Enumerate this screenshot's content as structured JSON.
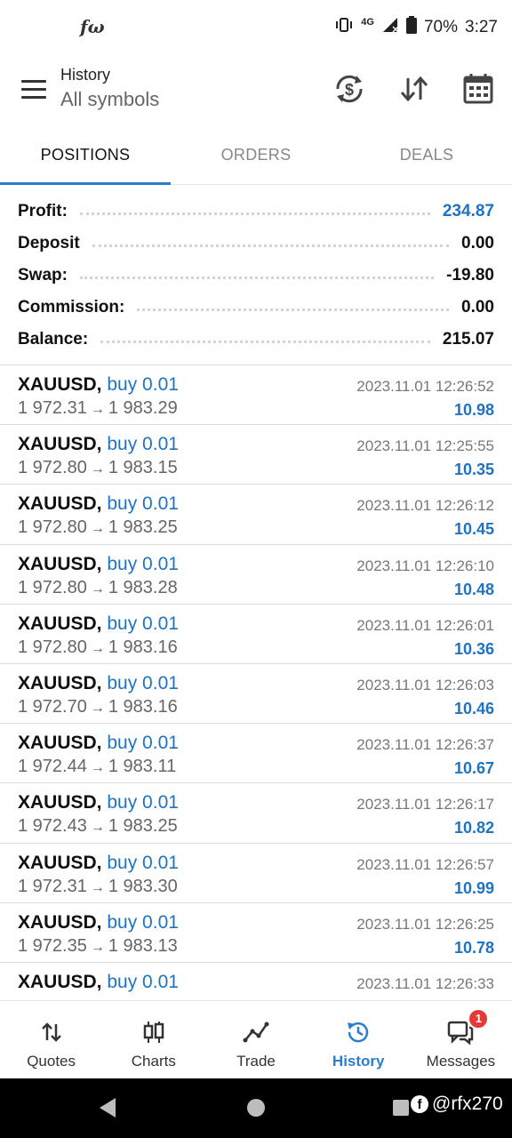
{
  "status_bar": {
    "left_icon": "fω",
    "network": "4G",
    "battery": "70%",
    "time": "3:27"
  },
  "header": {
    "title": "History",
    "subtitle": "All symbols"
  },
  "tabs": [
    {
      "label": "POSITIONS",
      "active": true
    },
    {
      "label": "ORDERS",
      "active": false
    },
    {
      "label": "DEALS",
      "active": false
    }
  ],
  "summary": [
    {
      "label": "Profit:",
      "value": "234.87"
    },
    {
      "label": "Deposit",
      "value": "0.00"
    },
    {
      "label": "Swap:",
      "value": "-19.80"
    },
    {
      "label": "Commission:",
      "value": "0.00"
    },
    {
      "label": "Balance:",
      "value": "215.07"
    }
  ],
  "trades": [
    {
      "symbol": "XAUUSD,",
      "side": "buy 0.01",
      "open": "1 972.31",
      "arrow": "→",
      "close": "1 983.29",
      "time": "2023.11.01 12:26:52",
      "profit": "10.98"
    },
    {
      "symbol": "XAUUSD,",
      "side": "buy 0.01",
      "open": "1 972.80",
      "arrow": "→",
      "close": "1 983.15",
      "time": "2023.11.01 12:25:55",
      "profit": "10.35"
    },
    {
      "symbol": "XAUUSD,",
      "side": "buy 0.01",
      "open": "1 972.80",
      "arrow": "→",
      "close": "1 983.25",
      "time": "2023.11.01 12:26:12",
      "profit": "10.45"
    },
    {
      "symbol": "XAUUSD,",
      "side": "buy 0.01",
      "open": "1 972.80",
      "arrow": "→",
      "close": "1 983.28",
      "time": "2023.11.01 12:26:10",
      "profit": "10.48"
    },
    {
      "symbol": "XAUUSD,",
      "side": "buy 0.01",
      "open": "1 972.80",
      "arrow": "→",
      "close": "1 983.16",
      "time": "2023.11.01 12:26:01",
      "profit": "10.36"
    },
    {
      "symbol": "XAUUSD,",
      "side": "buy 0.01",
      "open": "1 972.70",
      "arrow": "→",
      "close": "1 983.16",
      "time": "2023.11.01 12:26:03",
      "profit": "10.46"
    },
    {
      "symbol": "XAUUSD,",
      "side": "buy 0.01",
      "open": "1 972.44",
      "arrow": "→",
      "close": "1 983.11",
      "time": "2023.11.01 12:26:37",
      "profit": "10.67"
    },
    {
      "symbol": "XAUUSD,",
      "side": "buy 0.01",
      "open": "1 972.43",
      "arrow": "→",
      "close": "1 983.25",
      "time": "2023.11.01 12:26:17",
      "profit": "10.82"
    },
    {
      "symbol": "XAUUSD,",
      "side": "buy 0.01",
      "open": "1 972.31",
      "arrow": "→",
      "close": "1 983.30",
      "time": "2023.11.01 12:26:57",
      "profit": "10.99"
    },
    {
      "symbol": "XAUUSD,",
      "side": "buy 0.01",
      "open": "1 972.35",
      "arrow": "→",
      "close": "1 983.13",
      "time": "2023.11.01 12:26:25",
      "profit": "10.78"
    },
    {
      "symbol": "XAUUSD,",
      "side": "buy 0.01",
      "open": "",
      "arrow": "",
      "close": "",
      "time": "2023.11.01 12:26:33",
      "profit": ""
    }
  ],
  "bottom_nav": [
    {
      "label": "Quotes",
      "icon": "quotes-arrows-icon",
      "active": false
    },
    {
      "label": "Charts",
      "icon": "candlestick-icon",
      "active": false
    },
    {
      "label": "Trade",
      "icon": "trend-line-icon",
      "active": false
    },
    {
      "label": "History",
      "icon": "history-clock-icon",
      "active": true
    },
    {
      "label": "Messages",
      "icon": "chat-bubbles-icon",
      "active": false,
      "badge": "1"
    }
  ],
  "watermark": "@rfx270",
  "colors": {
    "accent": "#2a7dd1",
    "profit_blue": "#1f73c4",
    "badge_red": "#e53935"
  }
}
